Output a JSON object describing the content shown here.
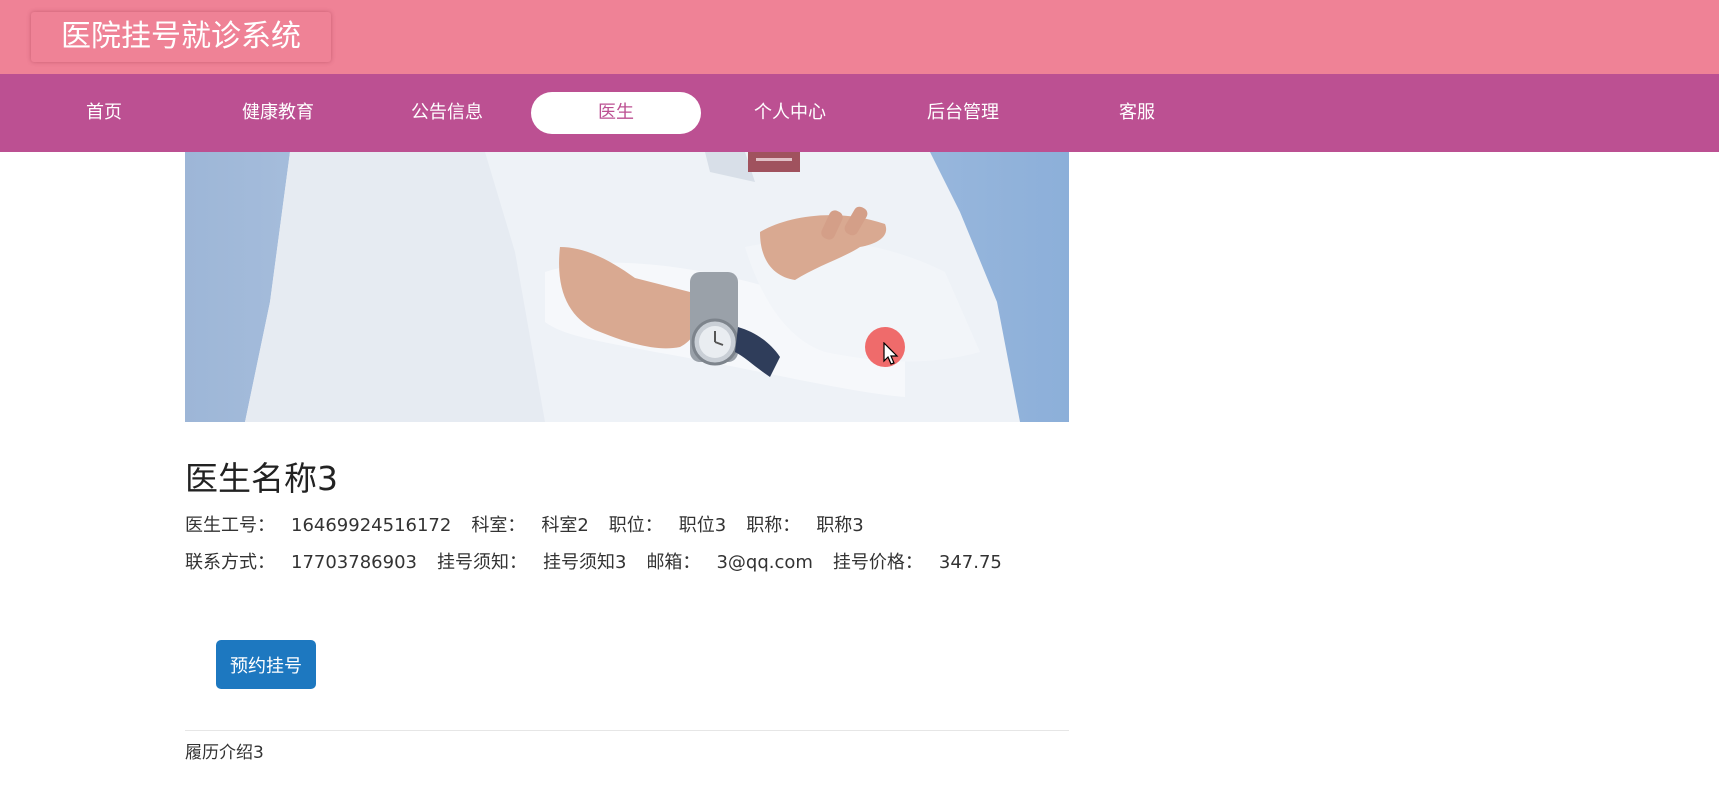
{
  "header": {
    "title": "医院挂号就诊系统"
  },
  "nav": {
    "items": [
      {
        "label": "首页",
        "active": false
      },
      {
        "label": "健康教育",
        "active": false
      },
      {
        "label": "公告信息",
        "active": false
      },
      {
        "label": "医生",
        "active": true
      },
      {
        "label": "个人中心",
        "active": false
      },
      {
        "label": "后台管理",
        "active": false
      },
      {
        "label": "客服",
        "active": false
      }
    ]
  },
  "doctor": {
    "name": "医生名称3",
    "fields": {
      "id_label": "医生工号：",
      "id_value": "16469924516172",
      "dept_label": "科室：",
      "dept_value": "科室2",
      "position_label": "职位：",
      "position_value": "职位3",
      "title_label": "职称：",
      "title_value": "职称3",
      "contact_label": "联系方式：",
      "contact_value": "17703786903",
      "notice_label": "挂号须知：",
      "notice_value": "挂号须知3",
      "email_label": "邮箱：",
      "email_value": "3@qq.com",
      "price_label": "挂号价格：",
      "price_value": "347.75"
    },
    "resume": "履历介绍3"
  },
  "actions": {
    "book_label": "预约挂号"
  },
  "colors": {
    "topbar": "#ef8296",
    "navbar": "#bc5092",
    "active_nav_bg": "#ffffff",
    "button": "#1d78c0"
  }
}
